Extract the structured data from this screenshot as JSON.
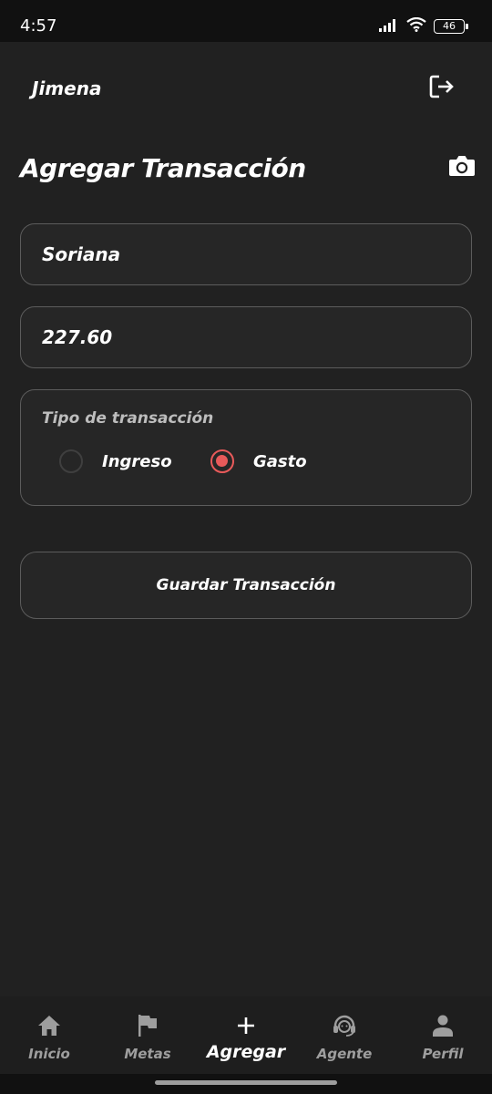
{
  "status_bar": {
    "time": "4:57",
    "battery": "46",
    "icons": [
      "signal-icon",
      "wifi-icon",
      "battery-icon"
    ]
  },
  "header": {
    "username": "Jimena",
    "logout_icon": "logout-icon"
  },
  "page": {
    "title": "Agregar Transacción",
    "camera_icon": "camera-icon"
  },
  "form": {
    "name_value": "Soriana",
    "amount_value": "227.60",
    "type_label": "Tipo de transacción",
    "options": [
      {
        "label": "Ingreso",
        "selected": false
      },
      {
        "label": "Gasto",
        "selected": true
      }
    ],
    "save_label": "Guardar Transacción"
  },
  "colors": {
    "background": "#212121",
    "accent_radio": "#e85a5a",
    "field_border": "#5c5c5c"
  },
  "nav": {
    "items": [
      {
        "label": "Inicio",
        "icon": "home-icon",
        "active": false
      },
      {
        "label": "Metas",
        "icon": "flag-icon",
        "active": false
      },
      {
        "label": "Agregar",
        "icon": "plus-icon",
        "active": true
      },
      {
        "label": "Agente",
        "icon": "support-agent-icon",
        "active": false
      },
      {
        "label": "Perfil",
        "icon": "person-icon",
        "active": false
      }
    ]
  }
}
